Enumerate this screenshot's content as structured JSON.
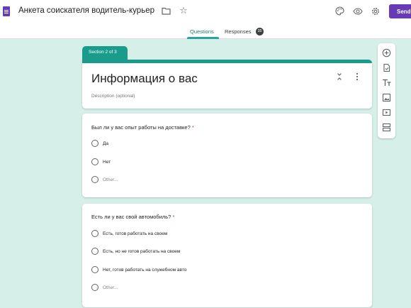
{
  "header": {
    "title": "Анкета соискателя водитель-курьер",
    "send_label": "Send",
    "tabs": [
      {
        "label": "Questions",
        "active": true
      },
      {
        "label": "Responses",
        "badge": "35"
      }
    ]
  },
  "section": {
    "tag": "Section 2 of 3",
    "title": "Информация о вас",
    "description_placeholder": "Description (optional)"
  },
  "questions": [
    {
      "title": "Был ли у вас опыт работы на доставке?",
      "required_mark": "*",
      "options": [
        "Да",
        "Нет"
      ],
      "other_label": "Other..."
    },
    {
      "title": "Есть ли у вас свой автомобиль?",
      "required_mark": "*",
      "options": [
        "Есть, готов работать на своем",
        "Есть, но не готов работать на своем",
        "Нет, готов работать на служебном авто"
      ],
      "other_label": "Other..."
    }
  ],
  "icons": {
    "top": [
      "folder-icon",
      "star-icon",
      "palette-icon",
      "eye-icon",
      "gear-icon"
    ],
    "toolbar": [
      "add-question-icon",
      "import-questions-icon",
      "title-text-icon",
      "image-icon",
      "video-icon",
      "section-icon"
    ]
  },
  "colors": {
    "accent": "#1a9c8c",
    "background": "#d7efe9",
    "brand": "#673ab7",
    "required": "#d93025"
  }
}
